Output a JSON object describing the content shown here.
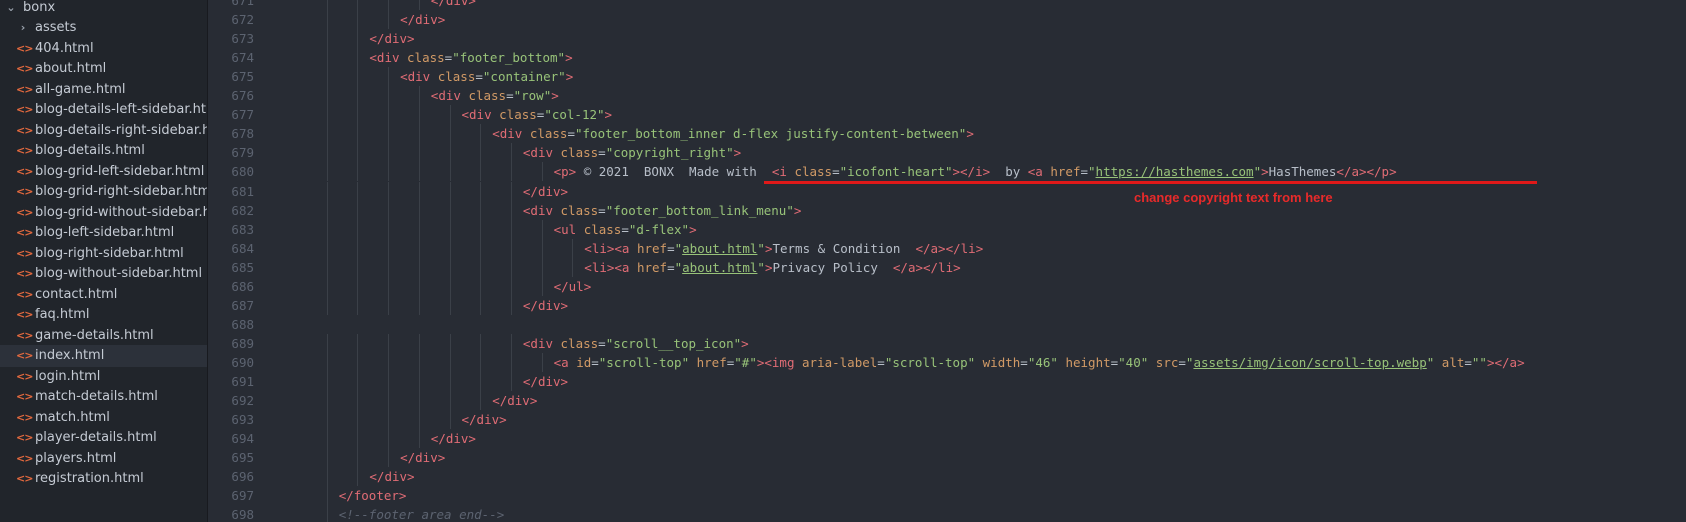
{
  "sidebar": {
    "root": {
      "label": "bonx",
      "icon": "chevron-down-icon"
    },
    "folders": [
      {
        "label": "assets",
        "icon": "chevron-right-icon"
      }
    ],
    "files": [
      "404.html",
      "about.html",
      "all-game.html",
      "blog-details-left-sidebar.html",
      "blog-details-right-sidebar.ht...",
      "blog-details.html",
      "blog-grid-left-sidebar.html",
      "blog-grid-right-sidebar.html",
      "blog-grid-without-sidebar.ht...",
      "blog-left-sidebar.html",
      "blog-right-sidebar.html",
      "blog-without-sidebar.html",
      "contact.html",
      "faq.html",
      "game-details.html",
      "index.html",
      "login.html",
      "match-details.html",
      "match.html",
      "player-details.html",
      "players.html",
      "registration.html"
    ],
    "selected_file": "index.html",
    "file_icon": "html-file-icon"
  },
  "editor": {
    "lines": [
      {
        "n": "671",
        "indent": 5,
        "tokens": [
          [
            "tag",
            "</div>"
          ]
        ]
      },
      {
        "n": "672",
        "indent": 4,
        "tokens": [
          [
            "tag",
            "</div>"
          ]
        ]
      },
      {
        "n": "673",
        "indent": 3,
        "tokens": [
          [
            "tag",
            "</div>"
          ]
        ]
      },
      {
        "n": "674",
        "indent": 3,
        "tokens": [
          [
            "tag",
            "<div"
          ],
          [
            "txt",
            " "
          ],
          [
            "attr",
            "class"
          ],
          [
            "punct",
            "="
          ],
          [
            "str",
            "\"footer_bottom\""
          ],
          [
            "tag",
            ">"
          ]
        ]
      },
      {
        "n": "675",
        "indent": 4,
        "tokens": [
          [
            "tag",
            "<div"
          ],
          [
            "txt",
            " "
          ],
          [
            "attr",
            "class"
          ],
          [
            "punct",
            "="
          ],
          [
            "str",
            "\"container\""
          ],
          [
            "tag",
            ">"
          ]
        ]
      },
      {
        "n": "676",
        "indent": 5,
        "tokens": [
          [
            "tag",
            "<div"
          ],
          [
            "txt",
            " "
          ],
          [
            "attr",
            "class"
          ],
          [
            "punct",
            "="
          ],
          [
            "str",
            "\"row\""
          ],
          [
            "tag",
            ">"
          ]
        ]
      },
      {
        "n": "677",
        "indent": 6,
        "tokens": [
          [
            "tag",
            "<div"
          ],
          [
            "txt",
            " "
          ],
          [
            "attr",
            "class"
          ],
          [
            "punct",
            "="
          ],
          [
            "str",
            "\"col-12\""
          ],
          [
            "tag",
            ">"
          ]
        ]
      },
      {
        "n": "678",
        "indent": 7,
        "tokens": [
          [
            "tag",
            "<div"
          ],
          [
            "txt",
            " "
          ],
          [
            "attr",
            "class"
          ],
          [
            "punct",
            "="
          ],
          [
            "str",
            "\"footer_bottom_inner d-flex justify-content-between\""
          ],
          [
            "tag",
            ">"
          ]
        ]
      },
      {
        "n": "679",
        "indent": 8,
        "tokens": [
          [
            "tag",
            "<div"
          ],
          [
            "txt",
            " "
          ],
          [
            "attr",
            "class"
          ],
          [
            "punct",
            "="
          ],
          [
            "str",
            "\"copyright_right\""
          ],
          [
            "tag",
            ">"
          ]
        ]
      },
      {
        "n": "680",
        "indent": 9,
        "tokens": [
          [
            "tag",
            "<p>"
          ],
          [
            "txt",
            " © 2021  BONX  Made with  "
          ],
          [
            "tag",
            "<i"
          ],
          [
            "txt",
            " "
          ],
          [
            "attr",
            "class"
          ],
          [
            "punct",
            "="
          ],
          [
            "str",
            "\"icofont-heart\""
          ],
          [
            "tag",
            "></i>"
          ],
          [
            "txt",
            "  by "
          ],
          [
            "tag",
            "<a"
          ],
          [
            "txt",
            " "
          ],
          [
            "attr",
            "href"
          ],
          [
            "punct",
            "="
          ],
          [
            "str",
            "\""
          ],
          [
            "url",
            "https://hasthemes.com"
          ],
          [
            "str",
            "\""
          ],
          [
            "tag",
            ">"
          ],
          [
            "txt",
            "HasThemes"
          ],
          [
            "tag",
            "</a></p>"
          ]
        ]
      },
      {
        "n": "681",
        "indent": 8,
        "tokens": [
          [
            "tag",
            "</div>"
          ]
        ]
      },
      {
        "n": "682",
        "indent": 8,
        "tokens": [
          [
            "tag",
            "<div"
          ],
          [
            "txt",
            " "
          ],
          [
            "attr",
            "class"
          ],
          [
            "punct",
            "="
          ],
          [
            "str",
            "\"footer_bottom_link_menu\""
          ],
          [
            "tag",
            ">"
          ]
        ]
      },
      {
        "n": "683",
        "indent": 9,
        "tokens": [
          [
            "tag",
            "<ul"
          ],
          [
            "txt",
            " "
          ],
          [
            "attr",
            "class"
          ],
          [
            "punct",
            "="
          ],
          [
            "str",
            "\"d-flex\""
          ],
          [
            "tag",
            ">"
          ]
        ]
      },
      {
        "n": "684",
        "indent": 10,
        "tokens": [
          [
            "tag",
            "<li><a"
          ],
          [
            "txt",
            " "
          ],
          [
            "attr",
            "href"
          ],
          [
            "punct",
            "="
          ],
          [
            "str",
            "\""
          ],
          [
            "url",
            "about.html"
          ],
          [
            "str",
            "\""
          ],
          [
            "tag",
            ">"
          ],
          [
            "txt",
            "Terms & Condition  "
          ],
          [
            "tag",
            "</a></li>"
          ]
        ]
      },
      {
        "n": "685",
        "indent": 10,
        "tokens": [
          [
            "tag",
            "<li><a"
          ],
          [
            "txt",
            " "
          ],
          [
            "attr",
            "href"
          ],
          [
            "punct",
            "="
          ],
          [
            "str",
            "\""
          ],
          [
            "url",
            "about.html"
          ],
          [
            "str",
            "\""
          ],
          [
            "tag",
            ">"
          ],
          [
            "txt",
            "Privacy Policy  "
          ],
          [
            "tag",
            "</a></li>"
          ]
        ]
      },
      {
        "n": "686",
        "indent": 9,
        "tokens": [
          [
            "tag",
            "</ul>"
          ]
        ]
      },
      {
        "n": "687",
        "indent": 8,
        "tokens": [
          [
            "tag",
            "</div>"
          ]
        ]
      },
      {
        "n": "688",
        "indent": 0,
        "tokens": []
      },
      {
        "n": "689",
        "indent": 8,
        "tokens": [
          [
            "tag",
            "<div"
          ],
          [
            "txt",
            " "
          ],
          [
            "attr",
            "class"
          ],
          [
            "punct",
            "="
          ],
          [
            "str",
            "\"scroll__top_icon\""
          ],
          [
            "tag",
            ">"
          ]
        ]
      },
      {
        "n": "690",
        "indent": 9,
        "tokens": [
          [
            "tag",
            "<a"
          ],
          [
            "txt",
            " "
          ],
          [
            "attr",
            "id"
          ],
          [
            "punct",
            "="
          ],
          [
            "str",
            "\"scroll-top\""
          ],
          [
            "txt",
            " "
          ],
          [
            "attr",
            "href"
          ],
          [
            "punct",
            "="
          ],
          [
            "str",
            "\"#\""
          ],
          [
            "tag",
            "><img"
          ],
          [
            "txt",
            " "
          ],
          [
            "attr",
            "aria-label"
          ],
          [
            "punct",
            "="
          ],
          [
            "str",
            "\"scroll-top\""
          ],
          [
            "txt",
            " "
          ],
          [
            "attr",
            "width"
          ],
          [
            "punct",
            "="
          ],
          [
            "str",
            "\"46\""
          ],
          [
            "txt",
            " "
          ],
          [
            "attr",
            "height"
          ],
          [
            "punct",
            "="
          ],
          [
            "str",
            "\"40\""
          ],
          [
            "txt",
            " "
          ],
          [
            "attr",
            "src"
          ],
          [
            "punct",
            "="
          ],
          [
            "str",
            "\""
          ],
          [
            "url",
            "assets/img/icon/scroll-top.webp"
          ],
          [
            "str",
            "\""
          ],
          [
            "txt",
            " "
          ],
          [
            "attr",
            "alt"
          ],
          [
            "punct",
            "="
          ],
          [
            "str",
            "\"\""
          ],
          [
            "tag",
            "></a>"
          ]
        ]
      },
      {
        "n": "691",
        "indent": 8,
        "tokens": [
          [
            "tag",
            "</div>"
          ]
        ]
      },
      {
        "n": "692",
        "indent": 7,
        "tokens": [
          [
            "tag",
            "</div>"
          ]
        ]
      },
      {
        "n": "693",
        "indent": 6,
        "tokens": [
          [
            "tag",
            "</div>"
          ]
        ]
      },
      {
        "n": "694",
        "indent": 5,
        "tokens": [
          [
            "tag",
            "</div>"
          ]
        ]
      },
      {
        "n": "695",
        "indent": 4,
        "tokens": [
          [
            "tag",
            "</div>"
          ]
        ]
      },
      {
        "n": "696",
        "indent": 3,
        "tokens": [
          [
            "tag",
            "</div>"
          ]
        ]
      },
      {
        "n": "697",
        "indent": 2,
        "tokens": [
          [
            "tag",
            "</footer>"
          ]
        ]
      },
      {
        "n": "698",
        "indent": 2,
        "tokens": [
          [
            "comment",
            "<!--footer area end-->"
          ]
        ]
      }
    ]
  },
  "annotation": {
    "note": "change copyright text from here",
    "color": "#e01919"
  }
}
